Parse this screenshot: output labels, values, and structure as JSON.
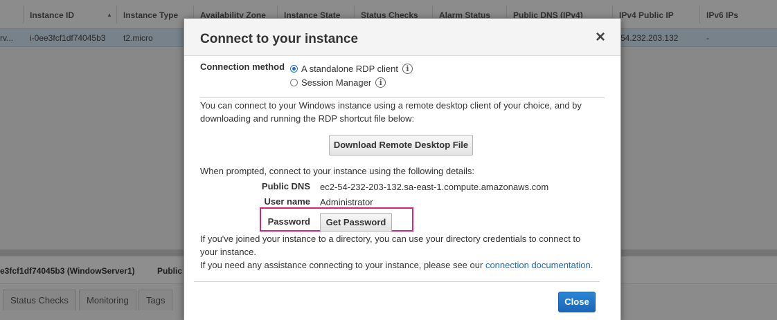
{
  "console": {
    "columns": [
      "Instance ID",
      "Instance Type",
      "Availability Zone",
      "Instance State",
      "Status Checks",
      "Alarm Status",
      "Public DNS (IPv4)",
      "IPv4 Public IP",
      "IPv6 IPs"
    ],
    "row": {
      "name_fragment": "rv...",
      "instance_id": "i-0ee3fcf1df74045b3",
      "instance_type": "t2.micro",
      "ipv4": "54.232.203.132",
      "ipv6": "-"
    },
    "details_title": "e3fcf1df74045b3 (WindowServer1)",
    "details_public_fragment": "Public",
    "tabs": [
      "Status Checks",
      "Monitoring",
      "Tags"
    ]
  },
  "modal": {
    "title": "Connect to your instance",
    "close_glyph": "×",
    "connection_method_label": "Connection method",
    "options": [
      "A standalone RDP client",
      "Session Manager"
    ],
    "selected_option": "A standalone RDP client",
    "info_glyph": "i",
    "intro": "You can connect to your Windows instance using a remote desktop client of your choice, and by downloading and running the RDP shortcut file below:",
    "download_button": "Download Remote Desktop File",
    "prompt": "When prompted, connect to your instance using the following details:",
    "details": {
      "public_dns_label": "Public DNS",
      "public_dns_value": "ec2-54-232-203-132.sa-east-1.compute.amazonaws.com",
      "user_name_label": "User name",
      "user_name_value": "Administrator",
      "password_label": "Password",
      "get_password_button": "Get Password"
    },
    "directory_note": "If you've joined your instance to a directory, you can use your directory credentials to connect to your instance.",
    "assistance_prefix": "If you need any assistance connecting to your instance, please see our",
    "assistance_link": "connection documentation",
    "assistance_suffix": ".",
    "close_button": "Close"
  },
  "colors": {
    "primary_button": "#1a66b8",
    "highlight_border": "#d6247a",
    "link": "#1a6ec0",
    "selected_row": "#cfe0ee"
  }
}
